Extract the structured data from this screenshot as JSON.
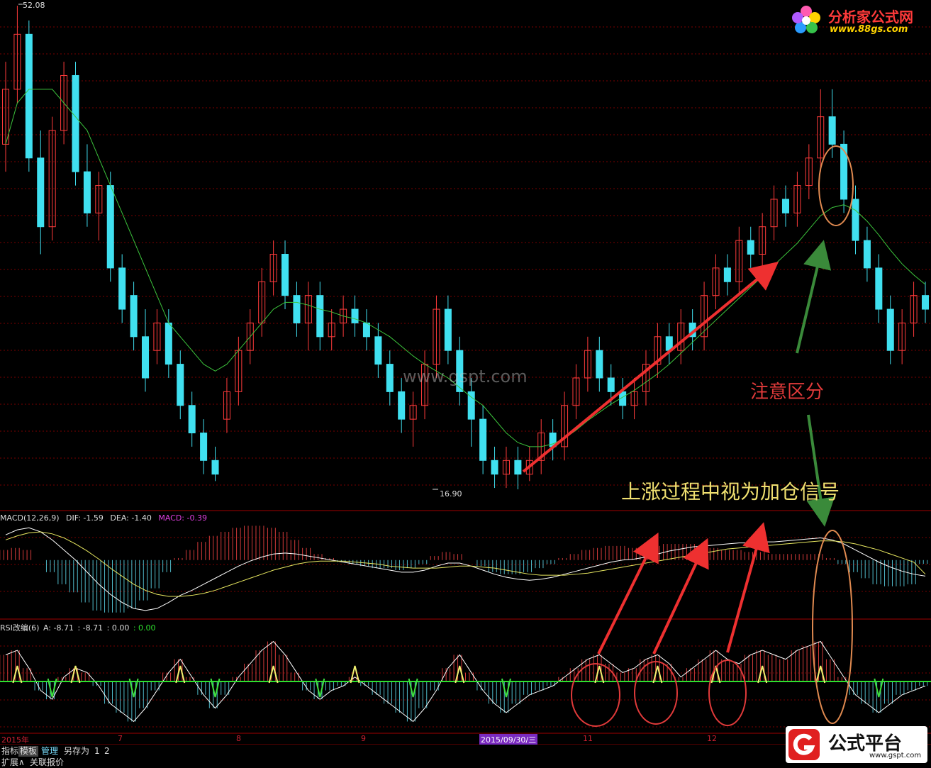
{
  "chart_data": {
    "type": "candlestick",
    "price_high_label": "52.08",
    "price_low_label": "16.90",
    "x_labels": [
      "2015年",
      "7",
      "8",
      "9",
      "2015/09/30/三",
      "11",
      "12"
    ],
    "candles": [
      {
        "o": 42,
        "c": 46,
        "h": 48,
        "l": 40
      },
      {
        "o": 46,
        "c": 50,
        "h": 52.08,
        "l": 45
      },
      {
        "o": 50,
        "c": 41,
        "h": 51,
        "l": 40
      },
      {
        "o": 41,
        "c": 36,
        "h": 43,
        "l": 34
      },
      {
        "o": 36,
        "c": 43,
        "h": 44,
        "l": 35
      },
      {
        "o": 43,
        "c": 47,
        "h": 48,
        "l": 42
      },
      {
        "o": 47,
        "c": 40,
        "h": 48,
        "l": 39
      },
      {
        "o": 40,
        "c": 37,
        "h": 42,
        "l": 36
      },
      {
        "o": 37,
        "c": 39,
        "h": 40,
        "l": 35
      },
      {
        "o": 39,
        "c": 33,
        "h": 40,
        "l": 32
      },
      {
        "o": 33,
        "c": 30,
        "h": 34,
        "l": 29
      },
      {
        "o": 31,
        "c": 28,
        "h": 32,
        "l": 27
      },
      {
        "o": 28,
        "c": 25,
        "h": 30,
        "l": 24
      },
      {
        "o": 27,
        "c": 29,
        "h": 30,
        "l": 26
      },
      {
        "o": 29,
        "c": 26,
        "h": 30,
        "l": 25
      },
      {
        "o": 26,
        "c": 23,
        "h": 27,
        "l": 22
      },
      {
        "o": 23,
        "c": 21,
        "h": 24,
        "l": 20
      },
      {
        "o": 21,
        "c": 19,
        "h": 22,
        "l": 18
      },
      {
        "o": 19,
        "c": 18,
        "h": 20,
        "l": 17.5
      },
      {
        "o": 22,
        "c": 24,
        "h": 25,
        "l": 21
      },
      {
        "o": 24,
        "c": 27,
        "h": 28,
        "l": 23
      },
      {
        "o": 27,
        "c": 29,
        "h": 30,
        "l": 26
      },
      {
        "o": 29,
        "c": 32,
        "h": 33,
        "l": 28
      },
      {
        "o": 32,
        "c": 34,
        "h": 35,
        "l": 31
      },
      {
        "o": 34,
        "c": 31,
        "h": 35,
        "l": 30
      },
      {
        "o": 31,
        "c": 29,
        "h": 32,
        "l": 28
      },
      {
        "o": 29,
        "c": 31,
        "h": 32,
        "l": 27
      },
      {
        "o": 31,
        "c": 28,
        "h": 32,
        "l": 27
      },
      {
        "o": 28,
        "c": 29,
        "h": 30,
        "l": 27
      },
      {
        "o": 29,
        "c": 30,
        "h": 31,
        "l": 28
      },
      {
        "o": 30,
        "c": 29,
        "h": 31,
        "l": 28
      },
      {
        "o": 29,
        "c": 28,
        "h": 30,
        "l": 27
      },
      {
        "o": 28,
        "c": 26,
        "h": 29,
        "l": 25
      },
      {
        "o": 26,
        "c": 24,
        "h": 27,
        "l": 23
      },
      {
        "o": 24,
        "c": 22,
        "h": 25,
        "l": 21
      },
      {
        "o": 22,
        "c": 23,
        "h": 24,
        "l": 20
      },
      {
        "o": 23,
        "c": 26,
        "h": 27,
        "l": 22
      },
      {
        "o": 26,
        "c": 30,
        "h": 31,
        "l": 25
      },
      {
        "o": 30,
        "c": 27,
        "h": 31,
        "l": 26
      },
      {
        "o": 27,
        "c": 24,
        "h": 28,
        "l": 23
      },
      {
        "o": 24,
        "c": 22,
        "h": 25,
        "l": 20
      },
      {
        "o": 22,
        "c": 19,
        "h": 23,
        "l": 18
      },
      {
        "o": 19,
        "c": 18,
        "h": 20,
        "l": 17
      },
      {
        "o": 18,
        "c": 19,
        "h": 20,
        "l": 17
      },
      {
        "o": 19,
        "c": 18,
        "h": 20,
        "l": 16.9
      },
      {
        "o": 18,
        "c": 19,
        "h": 20,
        "l": 17.5
      },
      {
        "o": 19,
        "c": 21,
        "h": 22,
        "l": 18
      },
      {
        "o": 21,
        "c": 20,
        "h": 22,
        "l": 19
      },
      {
        "o": 20,
        "c": 23,
        "h": 24,
        "l": 19
      },
      {
        "o": 23,
        "c": 25,
        "h": 26,
        "l": 22
      },
      {
        "o": 25,
        "c": 27,
        "h": 28,
        "l": 24
      },
      {
        "o": 27,
        "c": 25,
        "h": 28,
        "l": 24
      },
      {
        "o": 25,
        "c": 24,
        "h": 26,
        "l": 23
      },
      {
        "o": 24,
        "c": 23,
        "h": 25,
        "l": 22
      },
      {
        "o": 23,
        "c": 24,
        "h": 25,
        "l": 22
      },
      {
        "o": 24,
        "c": 26,
        "h": 27,
        "l": 23
      },
      {
        "o": 26,
        "c": 28,
        "h": 29,
        "l": 25
      },
      {
        "o": 28,
        "c": 27,
        "h": 29,
        "l": 26
      },
      {
        "o": 27,
        "c": 29,
        "h": 30,
        "l": 26
      },
      {
        "o": 29,
        "c": 28,
        "h": 30,
        "l": 27
      },
      {
        "o": 28,
        "c": 31,
        "h": 32,
        "l": 27
      },
      {
        "o": 31,
        "c": 33,
        "h": 34,
        "l": 30
      },
      {
        "o": 33,
        "c": 32,
        "h": 34,
        "l": 31
      },
      {
        "o": 32,
        "c": 35,
        "h": 36,
        "l": 31
      },
      {
        "o": 35,
        "c": 34,
        "h": 36,
        "l": 33
      },
      {
        "o": 34,
        "c": 36,
        "h": 37,
        "l": 33
      },
      {
        "o": 36,
        "c": 38,
        "h": 39,
        "l": 35
      },
      {
        "o": 38,
        "c": 37,
        "h": 39,
        "l": 36
      },
      {
        "o": 37,
        "c": 39,
        "h": 40,
        "l": 36
      },
      {
        "o": 39,
        "c": 41,
        "h": 42,
        "l": 38
      },
      {
        "o": 41,
        "c": 44,
        "h": 46,
        "l": 40
      },
      {
        "o": 44,
        "c": 42,
        "h": 46,
        "l": 41
      },
      {
        "o": 42,
        "c": 38,
        "h": 43,
        "l": 37
      },
      {
        "o": 38,
        "c": 35,
        "h": 39,
        "l": 34
      },
      {
        "o": 35,
        "c": 33,
        "h": 36,
        "l": 32
      },
      {
        "o": 33,
        "c": 30,
        "h": 34,
        "l": 29
      },
      {
        "o": 30,
        "c": 27,
        "h": 31,
        "l": 26
      },
      {
        "o": 27,
        "c": 29,
        "h": 30,
        "l": 26
      },
      {
        "o": 29,
        "c": 31,
        "h": 32,
        "l": 28
      },
      {
        "o": 31,
        "c": 30,
        "h": 32,
        "l": 29
      }
    ],
    "ma_line": [
      42,
      45,
      46,
      46,
      46,
      45,
      44,
      43,
      41,
      39,
      37,
      35,
      33,
      31,
      29,
      28,
      27,
      26,
      25.5,
      26,
      27,
      28,
      29,
      30,
      30.5,
      30.5,
      30.3,
      30,
      29.8,
      29.5,
      29.3,
      29,
      28.5,
      28,
      27.3,
      26.6,
      26,
      25.5,
      25,
      24.3,
      23.6,
      23,
      22,
      21,
      20.3,
      20,
      20,
      20.2,
      20.6,
      21.2,
      21.9,
      22.5,
      23.1,
      23.6,
      24.1,
      24.7,
      25.3,
      26,
      26.8,
      27.6,
      28.4,
      29.2,
      30,
      30.8,
      31.6,
      32.4,
      33.2,
      34,
      34.8,
      35.8,
      36.8,
      37.4,
      37.6,
      37.2,
      36.4,
      35.4,
      34.3,
      33.3,
      32.5,
      31.8
    ],
    "macd": {
      "title": "MACD(12,26,9)",
      "dif_label": "DIF: -1.59",
      "dea_label": "DEA: -1.40",
      "macd_label": "MACD: -0.39",
      "dif": [
        2.5,
        3,
        3.2,
        2.8,
        2,
        1,
        0,
        -1.2,
        -2.4,
        -3.4,
        -4.2,
        -4.8,
        -5,
        -4.8,
        -4.2,
        -3.5,
        -3,
        -2.4,
        -1.8,
        -1.2,
        -0.6,
        -0.1,
        0.3,
        0.6,
        0.7,
        0.6,
        0.4,
        0.2,
        0,
        -0.2,
        -0.4,
        -0.6,
        -0.8,
        -1,
        -1.2,
        -1.2,
        -1,
        -0.6,
        -0.3,
        -0.3,
        -0.6,
        -1,
        -1.4,
        -1.7,
        -1.9,
        -2,
        -1.9,
        -1.7,
        -1.4,
        -1.1,
        -0.8,
        -0.5,
        -0.2,
        0,
        0.1,
        0.3,
        0.6,
        0.9,
        1.1,
        1.3,
        1.4,
        1.5,
        1.6,
        1.7,
        1.7,
        1.8,
        1.8,
        1.9,
        2,
        2.1,
        2.2,
        2,
        1.6,
        1,
        0.4,
        -0.2,
        -0.7,
        -1.1,
        -1.4,
        -1.59
      ],
      "dea": [
        2,
        2.4,
        2.7,
        2.8,
        2.6,
        2.2,
        1.6,
        0.9,
        0.1,
        -0.8,
        -1.6,
        -2.4,
        -3,
        -3.4,
        -3.6,
        -3.6,
        -3.5,
        -3.3,
        -3,
        -2.6,
        -2.2,
        -1.8,
        -1.4,
        -1,
        -0.7,
        -0.4,
        -0.2,
        -0.1,
        -0.1,
        -0.1,
        -0.2,
        -0.3,
        -0.4,
        -0.6,
        -0.7,
        -0.8,
        -0.8,
        -0.8,
        -0.7,
        -0.6,
        -0.6,
        -0.7,
        -0.8,
        -1,
        -1.2,
        -1.4,
        -1.5,
        -1.5,
        -1.5,
        -1.4,
        -1.3,
        -1.1,
        -0.9,
        -0.7,
        -0.5,
        -0.3,
        -0.1,
        0.1,
        0.3,
        0.5,
        0.7,
        0.9,
        1.1,
        1.2,
        1.3,
        1.4,
        1.5,
        1.6,
        1.7,
        1.8,
        1.9,
        1.9,
        1.8,
        1.6,
        1.3,
        1,
        0.6,
        0.2,
        -0.2,
        -1.4
      ]
    },
    "rsi": {
      "title": "RSI改编(6)",
      "a_label": "A: -8.71",
      "b_label": ": -8.71",
      "c_label": ": 0.00",
      "d_label": ": 0.00",
      "values": [
        12,
        14,
        6,
        -4,
        -8,
        2,
        6,
        4,
        -2,
        -10,
        -14,
        -18,
        -12,
        -4,
        4,
        10,
        2,
        -6,
        -12,
        -6,
        2,
        8,
        14,
        18,
        12,
        4,
        -4,
        -8,
        -4,
        -2,
        2,
        -2,
        -6,
        -10,
        -14,
        -18,
        -12,
        -4,
        6,
        12,
        4,
        -4,
        -10,
        -14,
        -10,
        -6,
        -4,
        -2,
        2,
        6,
        10,
        12,
        8,
        4,
        6,
        10,
        12,
        8,
        2,
        6,
        10,
        14,
        10,
        8,
        12,
        14,
        12,
        10,
        14,
        16,
        18,
        10,
        2,
        -6,
        -10,
        -14,
        -10,
        -6,
        -4,
        -2
      ]
    },
    "annotations": {
      "note1": "注意区分",
      "note2": "上涨过程中视为加仓信号"
    }
  },
  "watermark": "www.gspt.com",
  "logo_top": {
    "title": "分析家公式网",
    "url": "www.88gs.com"
  },
  "logo_bottom": {
    "title": "公式平台",
    "url": "www.gspt.com"
  },
  "tabs": [
    "指标",
    "模板",
    "管理",
    "另存为",
    "1",
    "2"
  ],
  "tabs_row2": [
    "扩展∧",
    "关联报价"
  ],
  "colors": {
    "up": "#ff3b3b",
    "down": "#40e0f0",
    "ma": "#3cc43c",
    "grid": "#7a0000",
    "zero_rsi": "#2ee02e",
    "macd_label": "#e040e0",
    "arrow_red": "#ee3030",
    "arrow_green": "#3a8a3a",
    "ellipse": "#e08a50"
  }
}
